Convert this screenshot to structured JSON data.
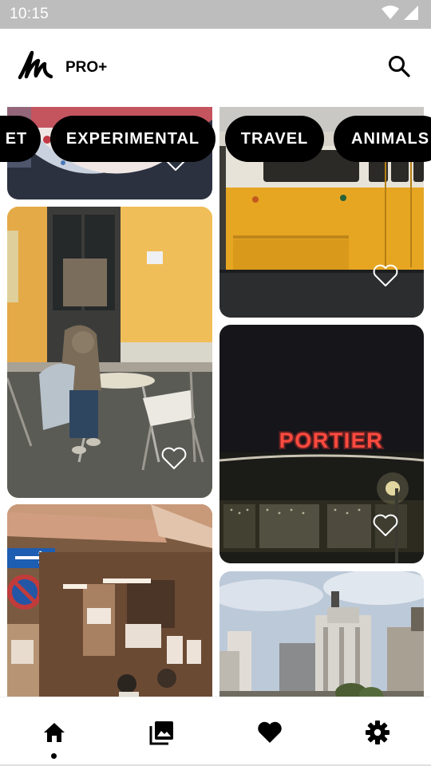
{
  "status_bar": {
    "time": "10:15",
    "icons": [
      "wifi-icon",
      "cellular-signal-icon"
    ]
  },
  "header": {
    "logo_icon": "signature-logo-icon",
    "pro_label": "PRO+",
    "search_icon": "search-icon"
  },
  "categories": [
    {
      "label": "ET"
    },
    {
      "label": "EXPERIMENTAL"
    },
    {
      "label": "TRAVEL"
    },
    {
      "label": "ANIMALS"
    }
  ],
  "feed": {
    "cards": [
      {
        "name": "photo-fabric-pattern",
        "icon": "heart-outline-icon"
      },
      {
        "name": "photo-cafe-person",
        "icon": "heart-outline-icon"
      },
      {
        "name": "photo-market-street",
        "icon": "heart-outline-icon"
      },
      {
        "name": "photo-yellow-tram",
        "icon": "heart-outline-icon"
      },
      {
        "name": "photo-portier-neon",
        "icon": "heart-outline-icon",
        "sign_text": "PORTIER"
      },
      {
        "name": "photo-city-buildings",
        "icon": "heart-outline-icon"
      }
    ]
  },
  "bottom_nav": {
    "items": [
      {
        "name": "home",
        "icon": "home-icon",
        "active": true
      },
      {
        "name": "gallery",
        "icon": "photo-library-icon",
        "active": false
      },
      {
        "name": "favorites",
        "icon": "heart-filled-icon",
        "active": false
      },
      {
        "name": "settings",
        "icon": "gear-icon",
        "active": false
      }
    ]
  },
  "colors": {
    "status_bar_bg": "#bdbdbd",
    "chip_bg": "#000000",
    "chip_text": "#ffffff",
    "icon": "#000000"
  }
}
